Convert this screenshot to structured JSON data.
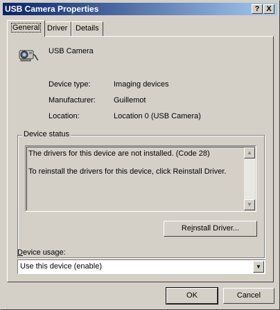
{
  "window": {
    "title": "USB Camera Properties",
    "help_button": "?",
    "close_button": "X"
  },
  "tabs": [
    {
      "label": "General",
      "active": true
    },
    {
      "label": "Driver",
      "active": false
    },
    {
      "label": "Details",
      "active": false
    }
  ],
  "device": {
    "name": "USB Camera",
    "icon": "usb-camera-icon",
    "properties": [
      {
        "label": "Device type:",
        "value": "Imaging devices"
      },
      {
        "label": "Manufacturer:",
        "value": "Guillemot"
      },
      {
        "label": "Location:",
        "value": "Location 0 (USB Camera)"
      }
    ]
  },
  "status": {
    "group_label": "Device status",
    "lines": [
      "The drivers for this device are not installed. (Code 28)",
      "To reinstall the drivers for this device, click Reinstall Driver."
    ],
    "reinstall_button": {
      "pre": "Re",
      "accel": "i",
      "post": "nstall Driver..."
    }
  },
  "usage": {
    "label_accel": "D",
    "label_rest": "evice usage:",
    "selected": "Use this device (enable)"
  },
  "footer": {
    "ok_label": "OK",
    "cancel_label": "Cancel"
  },
  "colors": {
    "titlebar_start": "#0a246a",
    "titlebar_end": "#a6caf0",
    "face": "#d4d0c8"
  }
}
